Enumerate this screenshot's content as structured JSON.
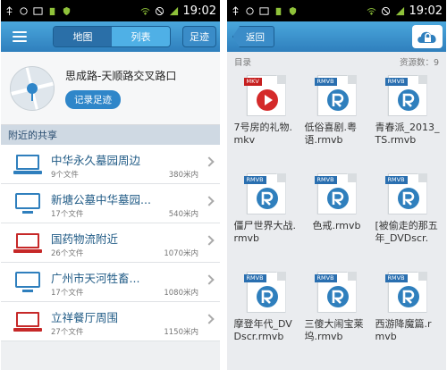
{
  "status": {
    "time": "19:02"
  },
  "left": {
    "tabs": {
      "map": "地图",
      "list": "列表"
    },
    "footprint": "足迹",
    "location": {
      "name": "思成路-天顺路交叉路口",
      "record": "记录足迹"
    },
    "section": "附近的共享",
    "places": [
      {
        "title": "中华永久墓园周边",
        "count": "9个文件",
        "distance": "380米内",
        "brand": "Lenovo"
      },
      {
        "title": "新塘公墓中华墓园...",
        "count": "17个文件",
        "distance": "540米内",
        "brand": ""
      },
      {
        "title": "国药物流附近",
        "count": "26个文件",
        "distance": "1070米内",
        "brand": "Great Wall"
      },
      {
        "title": "广州市天河牲畜...",
        "count": "17个文件",
        "distance": "1080米内",
        "brand": ""
      },
      {
        "title": "立祥餐厅周围",
        "count": "27个文件",
        "distance": "1150米内",
        "brand": "Great Wall"
      }
    ]
  },
  "right": {
    "back": "返回",
    "dir_label": "目录",
    "resource_count": "资源数：9",
    "files": [
      {
        "name": "7号房的礼物.mkv",
        "tag": "MKV"
      },
      {
        "name": "低俗喜剧.粤语.rmvb",
        "tag": "RMVB"
      },
      {
        "name": "青春派_2013_TS.rmvb",
        "tag": "RMVB"
      },
      {
        "name": "僵尸世界大战.rmvb",
        "tag": "RMVB"
      },
      {
        "name": "色戒.rmvb",
        "tag": "RMVB"
      },
      {
        "name": "[被偷走的那五年_DVDscr.",
        "tag": "RMVB"
      },
      {
        "name": "摩登年代_DVDscr.rmvb",
        "tag": "RMVB"
      },
      {
        "name": "三傻大闹宝莱坞.rmvb",
        "tag": "RMVB"
      },
      {
        "name": "西游降魔篇.rmvb",
        "tag": "RMVB"
      }
    ]
  }
}
